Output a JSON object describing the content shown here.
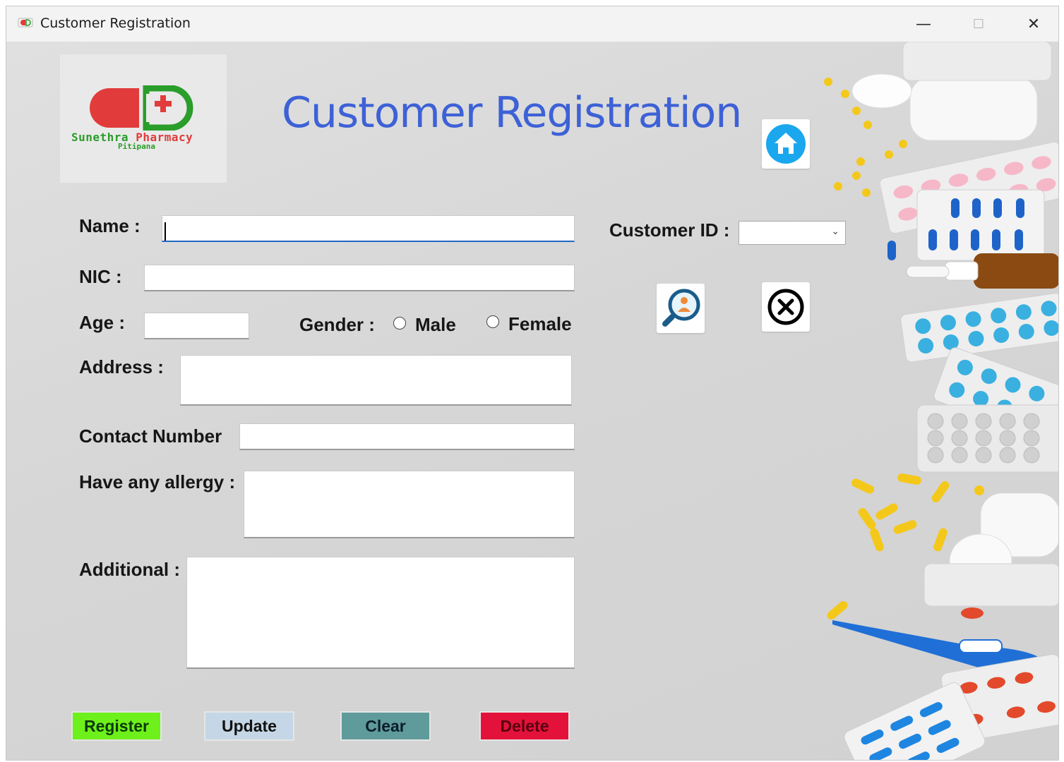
{
  "window": {
    "title": "Customer Registration",
    "minimize_glyph": "—",
    "maximize_glyph": "☐",
    "close_glyph": "✕"
  },
  "header": {
    "title": "Customer Registration",
    "logo": {
      "brand": "Sunethra Pharmacy",
      "brand_part1": "Sunethra",
      "brand_part2": "Pharmacy",
      "location": "Pitipana"
    },
    "home_icon": "home-icon"
  },
  "form": {
    "name_label": "Name :",
    "name_value": "",
    "nic_label": "NIC :",
    "nic_value": "",
    "age_label": "Age :",
    "age_value": "",
    "gender_label": "Gender :",
    "gender_options": [
      "Male",
      "Female"
    ],
    "gender_selected": "",
    "address_label": "Address :",
    "address_value": "",
    "contact_label": "Contact Number",
    "contact_value": "",
    "allergy_label": "Have any allergy :",
    "allergy_value": "",
    "additional_label": "Additional :",
    "additional_value": ""
  },
  "search": {
    "customer_id_label": "Customer ID :",
    "customer_id_value": "",
    "search_icon": "user-search-icon",
    "cancel_icon": "close-circle-icon"
  },
  "actions": {
    "register_label": "Register",
    "update_label": "Update",
    "clear_label": "Clear",
    "delete_label": "Delete"
  },
  "colors": {
    "title_blue": "#3d61d6",
    "register_bg": "#6ef01a",
    "update_bg": "#c5d7e6",
    "clear_bg": "#5e9b9a",
    "delete_bg": "#e3123a",
    "home_blue": "#1aa7ee",
    "logo_red": "#e23b3b",
    "logo_green": "#2a9d2a"
  }
}
